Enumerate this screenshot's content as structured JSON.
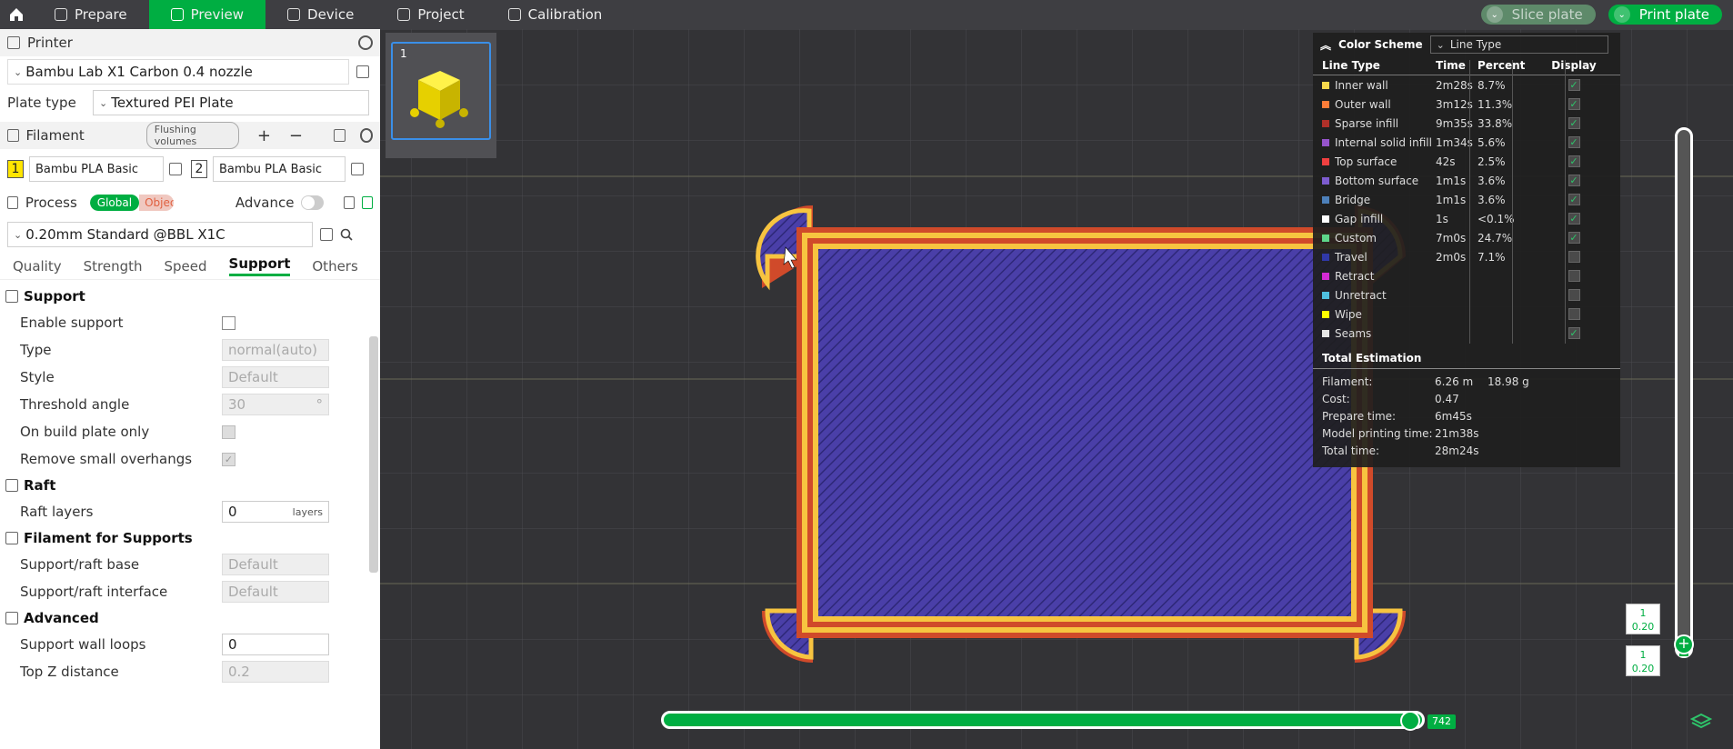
{
  "topbar": {
    "tabs": [
      "Prepare",
      "Preview",
      "Device",
      "Project",
      "Calibration"
    ],
    "slice_label": "Slice plate",
    "print_label": "Print plate",
    "colors": {
      "accent": "#00ae42",
      "bar": "#3e3e42"
    }
  },
  "printer": {
    "title": "Printer",
    "name": "Bambu Lab X1 Carbon 0.4 nozzle",
    "plate_type_label": "Plate type",
    "plate_type": "Textured PEI Plate"
  },
  "filament": {
    "title": "Filament",
    "flush_label": "Flushing volumes",
    "items": [
      {
        "num": "1",
        "name": "Bambu PLA Basic"
      },
      {
        "num": "2",
        "name": "Bambu PLA Basic"
      }
    ]
  },
  "process": {
    "title": "Process",
    "global_label": "Global",
    "objects_label": "Objects",
    "advance_label": "Advance",
    "preset": "0.20mm Standard @BBL X1C",
    "tabs": [
      "Quality",
      "Strength",
      "Speed",
      "Support",
      "Others"
    ]
  },
  "support": {
    "group": "Support",
    "enable_label": "Enable support",
    "type_label": "Type",
    "type_value": "normal(auto)",
    "style_label": "Style",
    "style_value": "Default",
    "threshold_label": "Threshold angle",
    "threshold_value": "30",
    "threshold_unit": "°",
    "build_plate_label": "On build plate only",
    "overhangs_label": "Remove small overhangs"
  },
  "raft": {
    "group": "Raft",
    "layers_label": "Raft layers",
    "layers_value": "0",
    "layers_unit": "layers"
  },
  "filament_supports": {
    "group": "Filament for Supports",
    "base_label": "Support/raft base",
    "base_value": "Default",
    "interface_label": "Support/raft interface",
    "interface_value": "Default"
  },
  "advanced": {
    "group": "Advanced",
    "wall_loops_label": "Support wall loops",
    "wall_loops_value": "0",
    "topz_label": "Top Z distance",
    "topz_value": "0.2"
  },
  "plate": {
    "number": "1"
  },
  "legend": {
    "title": "Color Scheme",
    "scheme": "Line Type",
    "cols": [
      "Line Type",
      "Time",
      "Percent",
      "Display"
    ],
    "rows": [
      {
        "name": "Inner wall",
        "time": "2m28s",
        "pct": "8.7%",
        "color": "#f7d94c",
        "shown": true
      },
      {
        "name": "Outer wall",
        "time": "3m12s",
        "pct": "11.3%",
        "color": "#ff7d38",
        "shown": true
      },
      {
        "name": "Sparse infill",
        "time": "9m35s",
        "pct": "33.8%",
        "color": "#b03029",
        "shown": true
      },
      {
        "name": "Internal solid infill",
        "time": "1m34s",
        "pct": "5.6%",
        "color": "#9654cc",
        "shown": true
      },
      {
        "name": "Top surface",
        "time": "42s",
        "pct": "2.5%",
        "color": "#f04040",
        "shown": true
      },
      {
        "name": "Bottom surface",
        "time": "1m1s",
        "pct": "3.6%",
        "color": "#7d5ccf",
        "shown": true
      },
      {
        "name": "Bridge",
        "time": "1m1s",
        "pct": "3.6%",
        "color": "#4d80ba",
        "shown": true
      },
      {
        "name": "Gap infill",
        "time": "1s",
        "pct": "<0.1%",
        "color": "#ffffff",
        "shown": true
      },
      {
        "name": "Custom",
        "time": "7m0s",
        "pct": "24.7%",
        "color": "#5ed68a",
        "shown": true
      },
      {
        "name": "Travel",
        "time": "2m0s",
        "pct": "7.1%",
        "color": "#3038a8",
        "shown": false
      },
      {
        "name": "Retract",
        "time": "",
        "pct": "",
        "color": "#d42ad4",
        "shown": false
      },
      {
        "name": "Unretract",
        "time": "",
        "pct": "",
        "color": "#4fc0e0",
        "shown": false
      },
      {
        "name": "Wipe",
        "time": "",
        "pct": "",
        "color": "#ffff00",
        "shown": false
      },
      {
        "name": "Seams",
        "time": "",
        "pct": "",
        "color": "#e6e6e6",
        "shown": true
      }
    ],
    "estimate_title": "Total Estimation",
    "filament_label": "Filament:",
    "filament_len": "6.26 m",
    "filament_weight": "18.98 g",
    "cost_label": "Cost:",
    "cost": "0.47",
    "prepare_label": "Prepare time:",
    "prepare": "6m45s",
    "model_label": "Model printing time:",
    "model": "21m38s",
    "total_label": "Total time:",
    "total": "28m24s"
  },
  "sliders": {
    "move_value": "742",
    "layer_top": "1",
    "height_top": "0.20",
    "layer_bottom": "1",
    "height_bottom": "0.20"
  }
}
